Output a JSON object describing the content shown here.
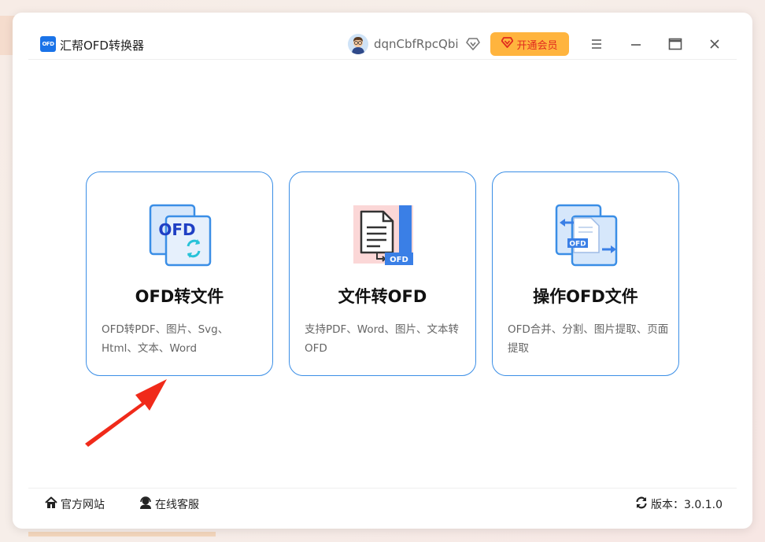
{
  "app": {
    "title": "汇帮OFD转换器",
    "logo_text": "OFD"
  },
  "header": {
    "username": "dqnCbfRpcQbi",
    "vip_button_label": "开通会员"
  },
  "cards": [
    {
      "title": "OFD转文件",
      "desc": "OFD转PDF、图片、Svg、Html、文本、Word",
      "icon_badge": "OFD"
    },
    {
      "title": "文件转OFD",
      "desc": "支持PDF、Word、图片、文本转OFD",
      "icon_badge": "OFD"
    },
    {
      "title": "操作OFD文件",
      "desc": "OFD合并、分割、图片提取、页面提取",
      "icon_badge": "OFD"
    }
  ],
  "footer": {
    "official_site": "官方网站",
    "online_service": "在线客服",
    "version_label": "版本：3.0.1.0"
  },
  "colors": {
    "accent": "#3a8ee6",
    "vip_bg": "#ffb43e",
    "vip_text": "#e02a1e",
    "annotation_arrow": "#f02a1a"
  }
}
